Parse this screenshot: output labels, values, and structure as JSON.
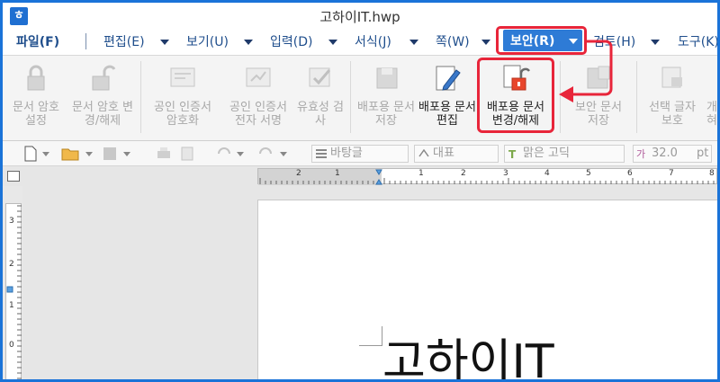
{
  "window": {
    "title": "고하이IT.hwp"
  },
  "menu": {
    "file": "파일(F)",
    "edit": "편집(E)",
    "view": "보기(U)",
    "input": "입력(D)",
    "format": "서식(J)",
    "page": "쪽(W)",
    "security": "보안(R)",
    "review": "검토(H)",
    "tools": "도구(K)"
  },
  "ribbon": {
    "doc_password_set": "문서 암호 설정",
    "doc_password_change": "문서 암호 변경/해제",
    "cert_encrypt": "공인 인증서 암호화",
    "cert_sign": "공인 인증서 전자 서명",
    "validity_check": "유효성 검사",
    "dist_save": "배포용 문서 저장",
    "dist_edit": "배포용 문서 편집",
    "dist_change": "배포용 문서 변경/해제",
    "security_save": "보안 문서 저장",
    "select_protect": "선택 글자 보호",
    "cut_right": "개 혀"
  },
  "toolbar": {
    "style": "바탕글",
    "representative": "대표",
    "font": "맑은 고딕",
    "size": "32.0",
    "unit": "pt"
  },
  "ruler": {
    "h_ticks": [
      "2",
      "1",
      "1",
      "2",
      "3",
      "4",
      "5",
      "6",
      "7",
      "8"
    ],
    "v_ticks": [
      "3",
      "2",
      "1",
      "0"
    ]
  },
  "document": {
    "text": "고하이IT"
  },
  "colors": {
    "accent": "#2e7bd6",
    "highlight": "#e8253a",
    "frame": "#1a73d8"
  }
}
